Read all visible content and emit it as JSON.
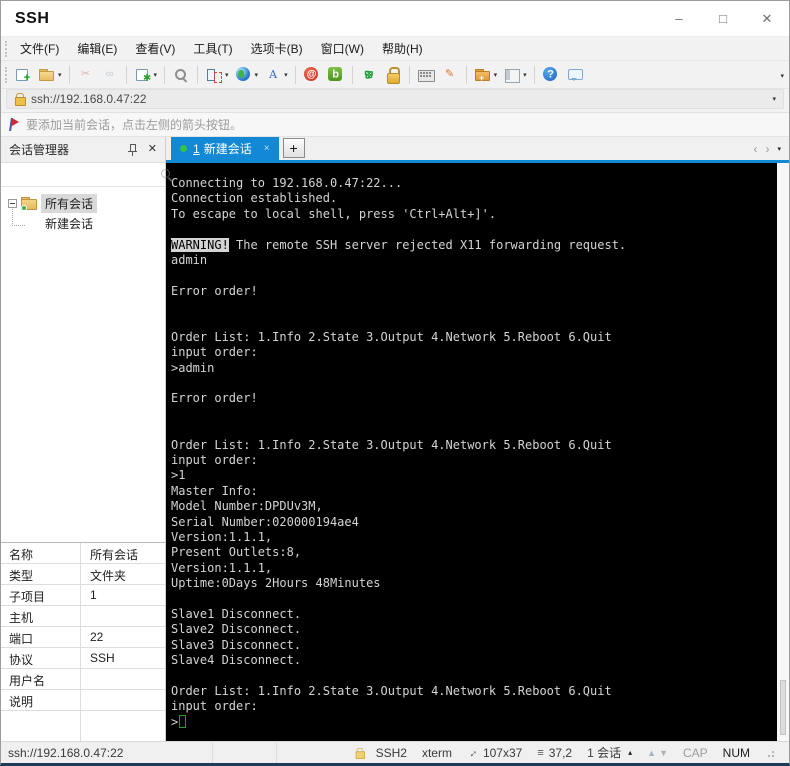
{
  "window": {
    "title": "SSH",
    "controls": {
      "minimize": "–",
      "maximize": "□",
      "close": "✕"
    }
  },
  "menu": {
    "items": [
      {
        "name": "menu-file",
        "label": "文件(F)"
      },
      {
        "name": "menu-edit",
        "label": "编辑(E)"
      },
      {
        "name": "menu-view",
        "label": "查看(V)"
      },
      {
        "name": "menu-tools",
        "label": "工具(T)"
      },
      {
        "name": "menu-tabs",
        "label": "选项卡(B)"
      },
      {
        "name": "menu-window",
        "label": "窗口(W)"
      },
      {
        "name": "menu-help",
        "label": "帮助(H)"
      }
    ]
  },
  "toolbar": {
    "overflow_caret": "▾",
    "groups": [
      [
        {
          "name": "new-session-icon",
          "shape": "new",
          "glyph": "+"
        },
        {
          "name": "open-folder-icon",
          "shape": "folder",
          "glyph": "",
          "caret": true
        }
      ],
      [
        {
          "name": "disconnect-icon",
          "shape": "plain",
          "glyph": "✂",
          "cls": "c-scissors",
          "disabled": true
        },
        {
          "name": "reconnect-icon",
          "shape": "plain",
          "glyph": "∞",
          "cls": "c-chain",
          "disabled": true
        }
      ],
      [
        {
          "name": "session-properties-icon",
          "shape": "newgear",
          "glyph": "✱",
          "caret": true
        }
      ],
      [
        {
          "name": "search-icon",
          "shape": "search",
          "glyph": ""
        }
      ],
      [
        {
          "name": "split-view-icon",
          "shape": "split",
          "glyph": "",
          "caret": true
        },
        {
          "name": "browser-icon",
          "shape": "globe",
          "glyph": "",
          "caret": true
        },
        {
          "name": "font-icon",
          "shape": "plain",
          "glyph": "A",
          "cls": "c-fontA",
          "caret": true
        }
      ],
      [
        {
          "name": "macro-icon",
          "shape": "circle-red",
          "glyph": "@"
        },
        {
          "name": "script-icon",
          "shape": "square-green",
          "glyph": "b"
        }
      ],
      [
        {
          "name": "fullscreen-icon",
          "shape": "expand",
          "glyph": "⇕"
        },
        {
          "name": "lock-icon",
          "shape": "lock",
          "glyph": ""
        }
      ],
      [
        {
          "name": "keyboard-icon",
          "shape": "keyboard",
          "glyph": ""
        },
        {
          "name": "highlighter-icon",
          "shape": "plain",
          "glyph": "✎",
          "cls": "c-pen"
        }
      ],
      [
        {
          "name": "transfer-folder-icon",
          "shape": "folder orange",
          "glyph": "+",
          "caret": true
        },
        {
          "name": "layout-icon",
          "shape": "panel",
          "glyph": "",
          "caret": true
        }
      ],
      [
        {
          "name": "help-icon",
          "shape": "circle-blue",
          "glyph": "?"
        },
        {
          "name": "feedback-icon",
          "shape": "bubble",
          "glyph": ""
        }
      ]
    ]
  },
  "address": {
    "value": "ssh://192.168.0.47:22",
    "caret": "▾"
  },
  "notice": {
    "text": "要添加当前会话，点击左侧的箭头按钮。"
  },
  "sidebar": {
    "header": {
      "title": "会话管理器",
      "close": "✕"
    },
    "tree": {
      "root": "所有会话",
      "child": "新建会话"
    },
    "properties": {
      "rows": [
        {
          "label": "名称",
          "value": "所有会话"
        },
        {
          "label": "类型",
          "value": "文件夹"
        },
        {
          "label": "子项目",
          "value": "1"
        },
        {
          "label": "主机",
          "value": ""
        },
        {
          "label": "端口",
          "value": "22"
        },
        {
          "label": "协议",
          "value": "SSH"
        },
        {
          "label": "用户名",
          "value": ""
        },
        {
          "label": "说明",
          "value": ""
        }
      ]
    }
  },
  "tabs": {
    "active_index": "1",
    "active_label": "新建会话",
    "close": "×",
    "new_tab": "+",
    "nav_prev": "‹",
    "nav_next": "›",
    "nav_overflow": "▾"
  },
  "terminal": {
    "lines": [
      {
        "text": "Connecting to 192.168.0.47:22..."
      },
      {
        "text": "Connection established."
      },
      {
        "text": "To escape to local shell, press 'Ctrl+Alt+]'."
      },
      {
        "text": ""
      },
      {
        "highlight": "WARNING!",
        "text": " The remote SSH server rejected X11 forwarding request."
      },
      {
        "text": "admin"
      },
      {
        "text": ""
      },
      {
        "text": "Error order!"
      },
      {
        "text": ""
      },
      {
        "text": ""
      },
      {
        "text": "Order List: 1.Info 2.State 3.Output 4.Network 5.Reboot 6.Quit"
      },
      {
        "text": "input order:"
      },
      {
        "text": ">admin"
      },
      {
        "text": ""
      },
      {
        "text": "Error order!"
      },
      {
        "text": ""
      },
      {
        "text": ""
      },
      {
        "text": "Order List: 1.Info 2.State 3.Output 4.Network 5.Reboot 6.Quit"
      },
      {
        "text": "input order:"
      },
      {
        "text": ">1"
      },
      {
        "text": "Master Info:"
      },
      {
        "text": "Model Number:DPDUv3M,"
      },
      {
        "text": "Serial Number:020000194ae4"
      },
      {
        "text": "Version:1.1.1,"
      },
      {
        "text": "Present Outlets:8,"
      },
      {
        "text": "Version:1.1.1,"
      },
      {
        "text": "Uptime:0Days 2Hours 48Minutes"
      },
      {
        "text": ""
      },
      {
        "text": "Slave1 Disconnect."
      },
      {
        "text": "Slave2 Disconnect."
      },
      {
        "text": "Slave3 Disconnect."
      },
      {
        "text": "Slave4 Disconnect."
      },
      {
        "text": ""
      },
      {
        "text": "Order List: 1.Info 2.State 3.Output 4.Network 5.Reboot 6.Quit"
      },
      {
        "text": "input order:"
      },
      {
        "text": ">",
        "cursor": true
      }
    ]
  },
  "status": {
    "url": "ssh://192.168.0.47:22",
    "encryption": "SSH2",
    "terminal_type": "xterm",
    "screen_size": "107x37",
    "cursor_position": "37,2",
    "session_count": "1 会话",
    "caps_indicator": "CAP",
    "num_indicator": "NUM"
  },
  "colors": {
    "tab_active_blue": "#1389d6",
    "terminal_background": "#000000",
    "terminal_foreground": "#d4d4d4",
    "cursor_green": "#17a817",
    "session_dot_green": "#35c04a",
    "lock_gold": "#eec04a"
  }
}
